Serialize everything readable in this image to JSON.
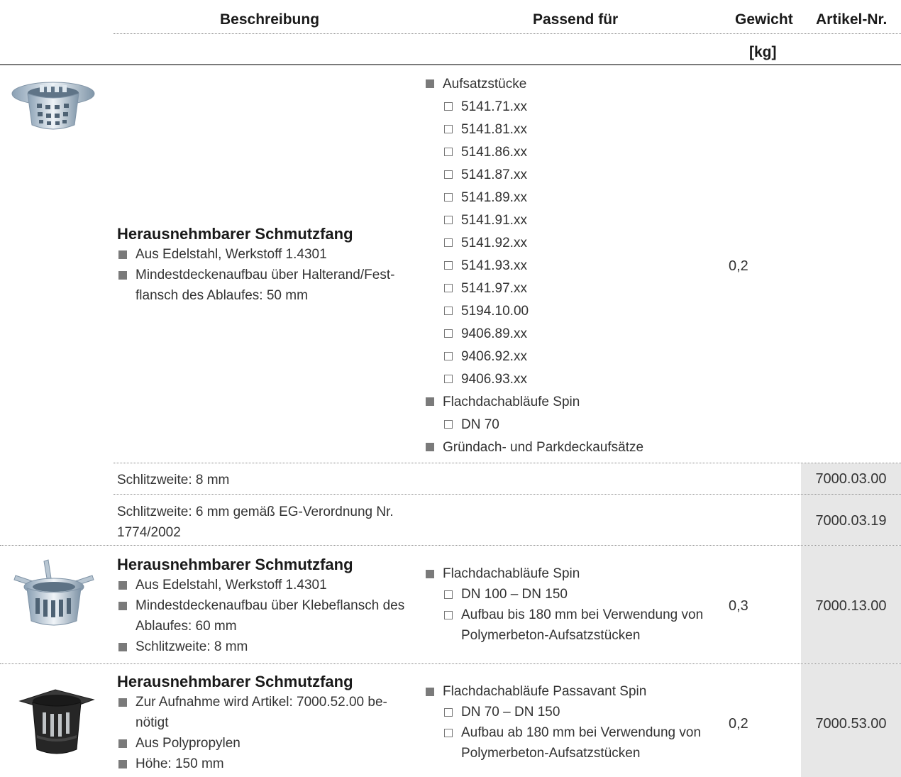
{
  "header": {
    "col_desc": "Beschreibung",
    "col_fit": "Passend für",
    "col_weight": "Gewicht",
    "col_weight_unit": "[kg]",
    "col_artnr": "Artikel-Nr."
  },
  "product1": {
    "image_icon": "stainless-strainer-with-rim",
    "title": "Herausnehmbarer Schmutzfang",
    "features": [
      "Aus Edelstahl, Werkstoff 1.4301",
      "Mindestdeckenaufbau über Halterand/Fest-flansch des Ablaufes: 50 mm"
    ],
    "fit_groups": [
      {
        "name": "Aufsatzstücke",
        "items": [
          "5141.71.xx",
          "5141.81.xx",
          "5141.86.xx",
          "5141.87.xx",
          "5141.89.xx",
          "5141.91.xx",
          "5141.92.xx",
          "5141.93.xx",
          "5141.97.xx",
          "5194.10.00",
          "9406.89.xx",
          "9406.92.xx",
          "9406.93.xx"
        ]
      },
      {
        "name": "Flachdachabläufe Spin",
        "items": [
          "DN 70"
        ]
      },
      {
        "name": "Gründach- und Parkdeckaufsätze",
        "items": []
      }
    ],
    "weight": "0,2",
    "variants": [
      {
        "desc": "Schlitzweite: 8 mm",
        "artnr": "7000.03.00"
      },
      {
        "desc": "Schlitzweite: 6 mm gemäß EG-Verordnung Nr. 1774/2002",
        "artnr": "7000.03.19"
      }
    ]
  },
  "product2": {
    "image_icon": "stainless-strainer-with-clips",
    "title": "Herausnehmbarer Schmutzfang",
    "features": [
      "Aus Edelstahl, Werkstoff 1.4301",
      "Mindestdeckenaufbau über Klebeflansch des Ablaufes: 60 mm",
      "Schlitzweite: 8 mm"
    ],
    "fit_groups": [
      {
        "name": "Flachdachabläufe Spin",
        "items": [
          "DN 100 – DN 150",
          "Aufbau bis 180 mm bei Verwendung von Polymerbeton-Aufsatzstücken"
        ]
      }
    ],
    "weight": "0,3",
    "artnr": "7000.13.00"
  },
  "product3": {
    "image_icon": "black-plastic-strainer",
    "title": "Herausnehmbarer Schmutzfang",
    "features": [
      "Zur Aufnahme wird Artikel: 7000.52.00 be-nötigt",
      "Aus Polypropylen",
      "Höhe: 150 mm"
    ],
    "fit_groups": [
      {
        "name": "Flachdachabläufe Passavant Spin",
        "items": [
          "DN 70 – DN 150",
          "Aufbau ab 180 mm bei Verwendung von Polymerbeton-Aufsatzstücken"
        ]
      }
    ],
    "weight": "0,2",
    "artnr": "7000.53.00"
  }
}
